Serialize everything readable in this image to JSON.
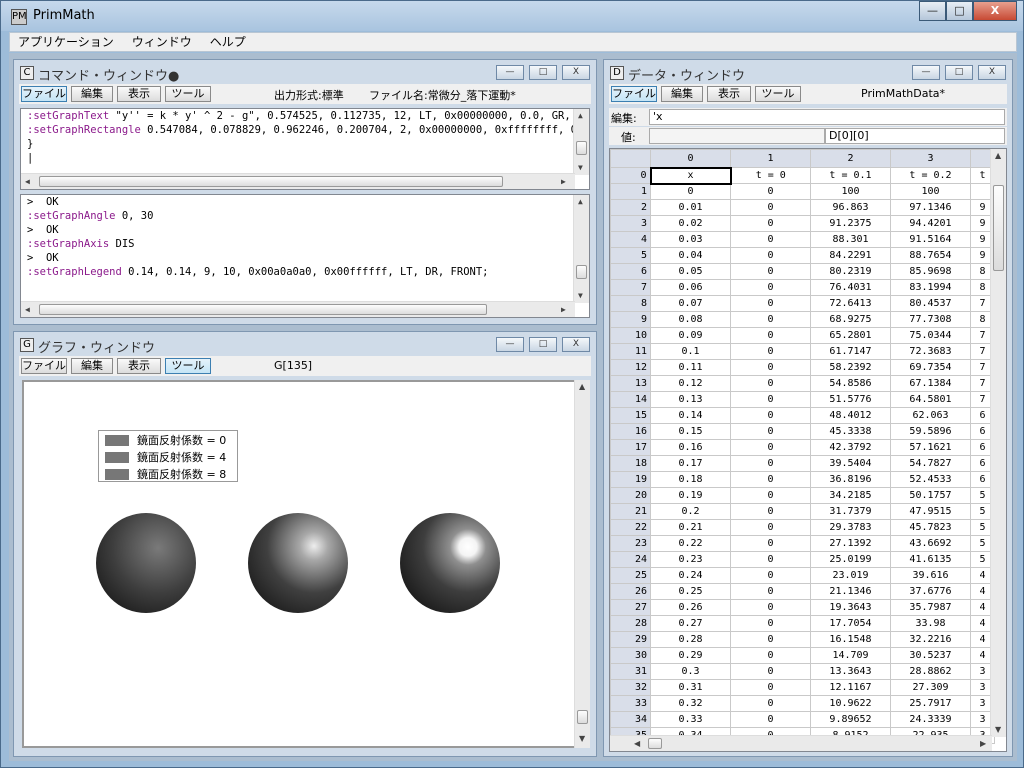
{
  "app": {
    "title": "PrimMath",
    "icon_label": "PM"
  },
  "window_controls": {
    "minimize": "—",
    "maximize": "□",
    "close": "X"
  },
  "menu": [
    "アプリケーション",
    "ウィンドウ",
    "ヘルプ"
  ],
  "command_window": {
    "icon": "C",
    "title": "コマンド・ウィンドウ●",
    "toolbar": [
      "ファイル",
      "編集",
      "表示",
      "ツール"
    ],
    "output_format": "出力形式:標準",
    "file_name": "ファイル名:常微分_落下運動*",
    "editor_lines": [
      {
        "kw": ":setGraphText",
        "rest": " \"y'' = k * y' ^ 2 - g\", 0.574525, 0.112735, 12, LT, 0x00000000, 0.0, GR,"
      },
      {
        "kw": ":setGraphRectangle",
        "rest": " 0.547084, 0.078829, 0.962246, 0.200704, 2, 0x00000000, 0xffffffff, 0"
      },
      {
        "kw": "",
        "rest": "}"
      },
      {
        "kw": "",
        "rest": "|"
      }
    ],
    "console_lines": [
      {
        "kw": "",
        "rest": ">  OK"
      },
      {
        "kw": ":setGraphAngle",
        "rest": " 0, 30"
      },
      {
        "kw": "",
        "rest": ">  OK"
      },
      {
        "kw": ":setGraphAxis",
        "rest": " DIS"
      },
      {
        "kw": "",
        "rest": ">  OK"
      },
      {
        "kw": ":setGraphLegend",
        "rest": " 0.14, 0.14, 9, 10, 0x00a0a0a0, 0x00ffffff, LT, DR, FRONT;"
      }
    ]
  },
  "graph_window": {
    "icon": "G",
    "title": "グラフ・ウィンドウ",
    "toolbar": [
      "ファイル",
      "編集",
      "表示",
      "ツール"
    ],
    "graph_id": "G[135]",
    "legend": [
      "鏡面反射係数 = 0",
      "鏡面反射係数 = 4",
      "鏡面反射係数 = 8"
    ],
    "spheres": [
      {
        "specular": 0
      },
      {
        "specular": 4
      },
      {
        "specular": 8
      }
    ]
  },
  "data_window": {
    "icon": "D",
    "title": "データ・ウィンドウ",
    "toolbar": [
      "ファイル",
      "編集",
      "表示",
      "ツール"
    ],
    "data_name": "PrimMathData*",
    "edit_label": "編集:",
    "edit_value": "'x",
    "value_label": "値:",
    "cell_ref": "D[0][0]",
    "columns": [
      "0",
      "1",
      "2",
      "3",
      ""
    ],
    "rows": [
      [
        "0",
        "x",
        "t = 0",
        "t = 0.1",
        "t = 0.2",
        "t"
      ],
      [
        "1",
        "0",
        "0",
        "100",
        "100",
        ""
      ],
      [
        "2",
        "0.01",
        "0",
        "96.863",
        "97.1346",
        "9"
      ],
      [
        "3",
        "0.02",
        "0",
        "91.2375",
        "94.4201",
        "9"
      ],
      [
        "4",
        "0.03",
        "0",
        "88.301",
        "91.5164",
        "9"
      ],
      [
        "5",
        "0.04",
        "0",
        "84.2291",
        "88.7654",
        "9"
      ],
      [
        "6",
        "0.05",
        "0",
        "80.2319",
        "85.9698",
        "8"
      ],
      [
        "7",
        "0.06",
        "0",
        "76.4031",
        "83.1994",
        "8"
      ],
      [
        "8",
        "0.07",
        "0",
        "72.6413",
        "80.4537",
        "7"
      ],
      [
        "9",
        "0.08",
        "0",
        "68.9275",
        "77.7308",
        "8"
      ],
      [
        "10",
        "0.09",
        "0",
        "65.2801",
        "75.0344",
        "7"
      ],
      [
        "11",
        "0.1",
        "0",
        "61.7147",
        "72.3683",
        "7"
      ],
      [
        "12",
        "0.11",
        "0",
        "58.2392",
        "69.7354",
        "7"
      ],
      [
        "13",
        "0.12",
        "0",
        "54.8586",
        "67.1384",
        "7"
      ],
      [
        "14",
        "0.13",
        "0",
        "51.5776",
        "64.5801",
        "7"
      ],
      [
        "15",
        "0.14",
        "0",
        "48.4012",
        "62.063",
        "6"
      ],
      [
        "16",
        "0.15",
        "0",
        "45.3338",
        "59.5896",
        "6"
      ],
      [
        "17",
        "0.16",
        "0",
        "42.3792",
        "57.1621",
        "6"
      ],
      [
        "18",
        "0.17",
        "0",
        "39.5404",
        "54.7827",
        "6"
      ],
      [
        "19",
        "0.18",
        "0",
        "36.8196",
        "52.4533",
        "6"
      ],
      [
        "20",
        "0.19",
        "0",
        "34.2185",
        "50.1757",
        "5"
      ],
      [
        "21",
        "0.2",
        "0",
        "31.7379",
        "47.9515",
        "5"
      ],
      [
        "22",
        "0.21",
        "0",
        "29.3783",
        "45.7823",
        "5"
      ],
      [
        "23",
        "0.22",
        "0",
        "27.1392",
        "43.6692",
        "5"
      ],
      [
        "24",
        "0.23",
        "0",
        "25.0199",
        "41.6135",
        "5"
      ],
      [
        "25",
        "0.24",
        "0",
        "23.019",
        "39.616",
        "4"
      ],
      [
        "26",
        "0.25",
        "0",
        "21.1346",
        "37.6776",
        "4"
      ],
      [
        "27",
        "0.26",
        "0",
        "19.3643",
        "35.7987",
        "4"
      ],
      [
        "28",
        "0.27",
        "0",
        "17.7054",
        "33.98",
        "4"
      ],
      [
        "29",
        "0.28",
        "0",
        "16.1548",
        "32.2216",
        "4"
      ],
      [
        "30",
        "0.29",
        "0",
        "14.709",
        "30.5237",
        "4"
      ],
      [
        "31",
        "0.3",
        "0",
        "13.3643",
        "28.8862",
        "3"
      ],
      [
        "32",
        "0.31",
        "0",
        "12.1167",
        "27.309",
        "3"
      ],
      [
        "33",
        "0.32",
        "0",
        "10.9622",
        "25.7917",
        "3"
      ],
      [
        "34",
        "0.33",
        "0",
        "9.89652",
        "24.3339",
        "3"
      ],
      [
        "35",
        "0.34",
        "0",
        "8.9152",
        "22.935",
        "3"
      ]
    ]
  }
}
